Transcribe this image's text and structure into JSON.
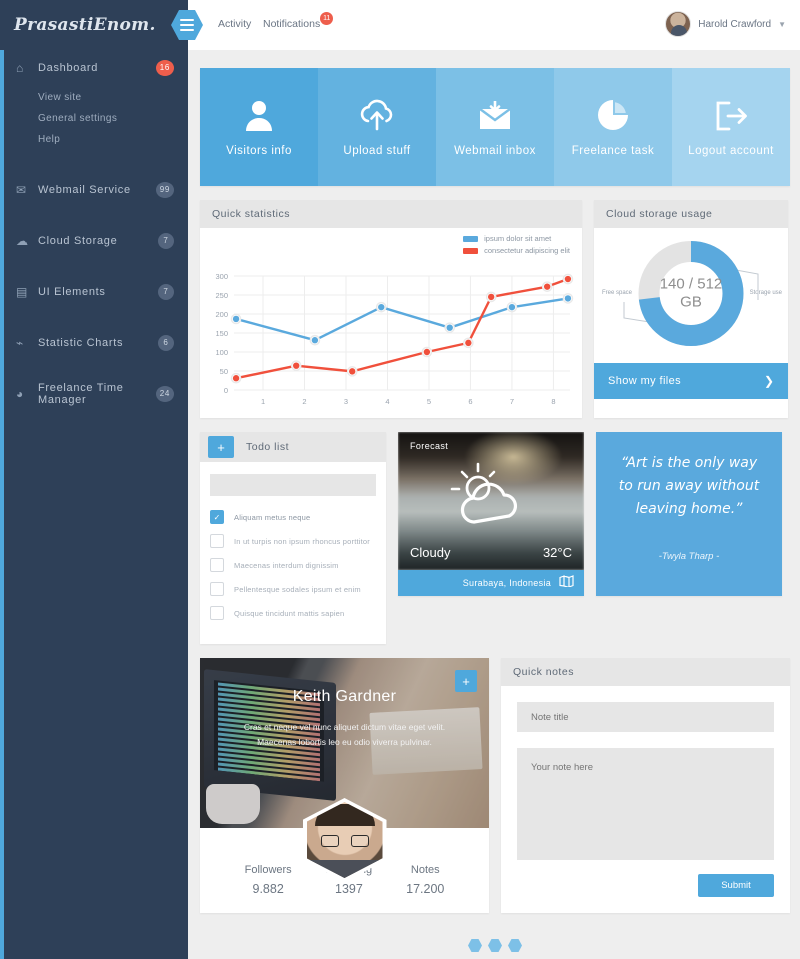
{
  "brand": {
    "logo": "PrasastiEnom.",
    "accent": "#4fa8dc",
    "sidebar_bg": "#2e4058",
    "danger": "#ee5e4c"
  },
  "topbar": {
    "menu_icon": "hamburger-icon",
    "nav": [
      {
        "label": "Activity",
        "badge": ""
      },
      {
        "label": "Notifications",
        "badge": "11"
      }
    ],
    "user": {
      "name": "Harold Crawford",
      "chevron": "▼"
    }
  },
  "sidebar": {
    "items": [
      {
        "label": "Dashboard",
        "icon": "home-icon",
        "badge": "16",
        "badge_style": "red"
      },
      {
        "label": "Webmail Service",
        "icon": "envelope-icon",
        "badge": "99",
        "badge_style": "muted"
      },
      {
        "label": "Cloud Storage",
        "icon": "cloud-icon",
        "badge": "7",
        "badge_style": "muted"
      },
      {
        "label": "UI Elements",
        "icon": "window-icon",
        "badge": "7",
        "badge_style": "muted"
      },
      {
        "label": "Statistic Charts",
        "icon": "chart-line-icon",
        "badge": "6",
        "badge_style": "muted"
      },
      {
        "label": "Freelance Time Manager",
        "icon": "clock-icon",
        "badge": "24",
        "badge_style": "muted"
      }
    ],
    "dashboard_sub": [
      "View site",
      "General settings",
      "Help"
    ]
  },
  "tiles": [
    {
      "label": "Visitors info",
      "icon": "user-icon",
      "color": "#4fa8dc"
    },
    {
      "label": "Upload stuff",
      "icon": "cloud-upload-icon",
      "color": "#63b2e0"
    },
    {
      "label": "Webmail inbox",
      "icon": "mail-download-icon",
      "color": "#7cc0e6"
    },
    {
      "label": "Freelance task",
      "icon": "pie-chart-icon",
      "color": "#8fc9ea"
    },
    {
      "label": "Logout account",
      "icon": "logout-icon",
      "color": "#a5d4ef"
    }
  ],
  "quick_statistics": {
    "title": "Quick statistics"
  },
  "chart_data": {
    "type": "line",
    "title": "Quick statistics",
    "xlabel": "",
    "ylabel": "",
    "ylim": [
      0,
      300
    ],
    "yticks": [
      0,
      50,
      100,
      150,
      200,
      250,
      300
    ],
    "xticks": [
      1,
      2,
      3,
      4,
      5,
      6,
      7,
      8
    ],
    "xlim": [
      0.3,
      8.4
    ],
    "grid": true,
    "legend_position": "top-right",
    "series": [
      {
        "name": "ipsum dolor sit amet",
        "color": "#5aa9dd",
        "x": [
          0.35,
          2.25,
          3.85,
          5.5,
          7.0,
          8.35
        ],
        "values": [
          187,
          131,
          218,
          164,
          218,
          241
        ]
      },
      {
        "name": "consectetur adipiscing elit",
        "color": "#f0503c",
        "x": [
          0.35,
          1.8,
          3.15,
          4.95,
          5.95,
          6.5,
          7.85,
          8.35
        ],
        "values": [
          31,
          64,
          49,
          100,
          124,
          245,
          272,
          292
        ]
      }
    ]
  },
  "storage": {
    "title": "Cloud storage usage",
    "center_line1": "140 / 512",
    "center_line2": "GB",
    "used_gb": 140,
    "total_gb": 512,
    "used_percent": 73,
    "label_free": "Free space",
    "label_used": "Storage use",
    "button": "Show my files",
    "button_arrow": "❯",
    "used_color": "#5aa9dd",
    "free_color": "#e3e3e3"
  },
  "todo": {
    "title": "Todo list",
    "add_icon": "plus-icon",
    "input_value": "",
    "input_placeholder": "",
    "items": [
      {
        "text": "Aliquam metus neque",
        "checked": true
      },
      {
        "text": "In ut turpis non ipsum rhoncus porttitor",
        "checked": false
      },
      {
        "text": "Maecenas interdum dignissim",
        "checked": false
      },
      {
        "text": "Pellentesque sodales ipsum et enim",
        "checked": false
      },
      {
        "text": "Quisque tincidunt mattis sapien",
        "checked": false
      }
    ]
  },
  "forecast": {
    "label": "Forecast",
    "condition": "Cloudy",
    "temperature": "32°C",
    "location": "Surabaya, Indonesia",
    "map_icon": "map-icon",
    "weather_icon": "sun-cloud-icon"
  },
  "quote": {
    "text": "“Art is the only way to run away without leaving home.”",
    "author": "-Twyla Tharp -"
  },
  "profile": {
    "name": "Keith Gardner",
    "description": "Cras et neque vel nunc aliquet dictum vitae eget velit. Maecenas lobortis leo eu odio viverra pulvinar.",
    "add_icon": "plus-icon",
    "avatar": "avatar-keith-gardner",
    "stats": [
      {
        "label": "Followers",
        "value": "9.882"
      },
      {
        "label": "Following",
        "value": "1397"
      },
      {
        "label": "Notes",
        "value": "17.200"
      }
    ]
  },
  "quick_notes": {
    "title": "Quick notes",
    "title_value": "",
    "title_placeholder": "Note title",
    "body_value": "",
    "body_placeholder": "Your note here",
    "submit": "Submit"
  },
  "pager": {
    "dots": 3,
    "active": 0
  }
}
